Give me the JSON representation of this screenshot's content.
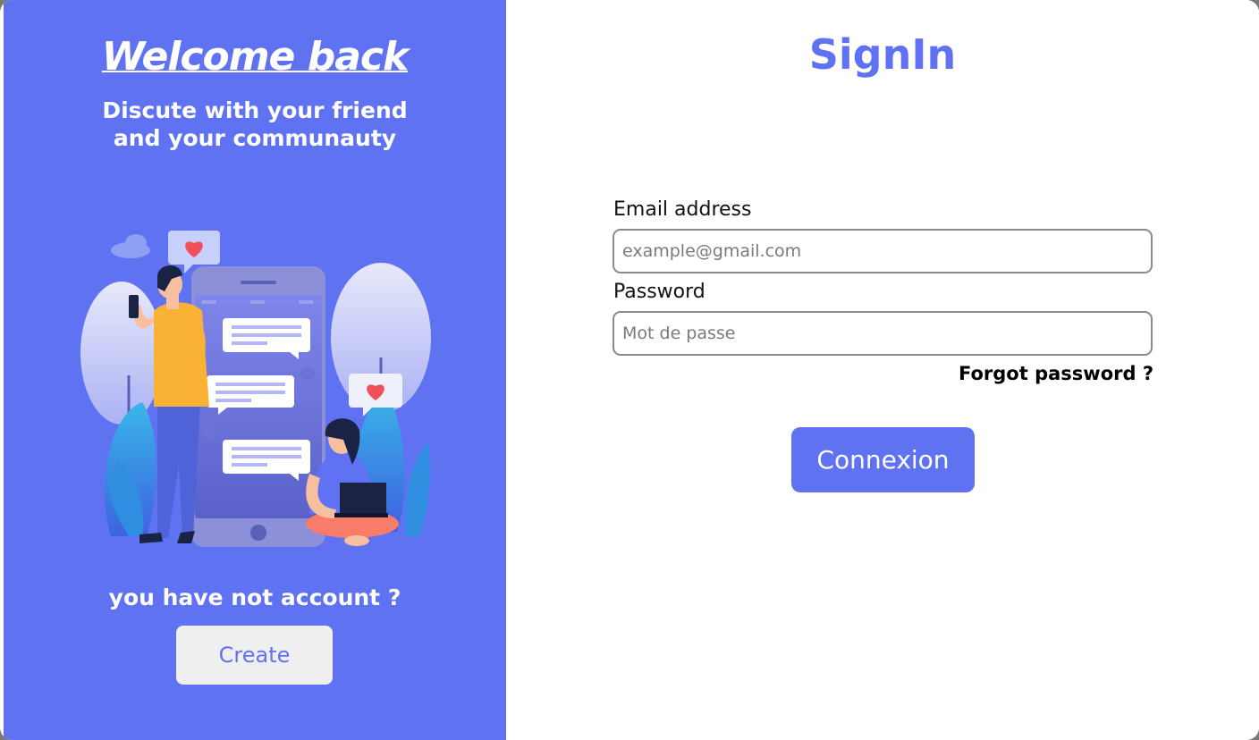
{
  "left_panel": {
    "welcome_title": "Welcome back",
    "subtitle": "Discute with your friend and your communauty",
    "no_account_text": "you have not account ?",
    "create_button_label": "Create",
    "background_color": "#5f73f2"
  },
  "signin": {
    "title": "SignIn",
    "email_label": "Email address",
    "email_placeholder": "example@gmail.com",
    "email_value": "",
    "password_label": "Password",
    "password_placeholder": "Mot de passe",
    "password_value": "",
    "forgot_password_label": "Forgot password ?",
    "connexion_button_label": "Connexion"
  },
  "theme": {
    "accent": "#5f73f2",
    "create_button_bg": "#efefef"
  },
  "illustration": {
    "description_icon": "social-chat-illustration"
  }
}
